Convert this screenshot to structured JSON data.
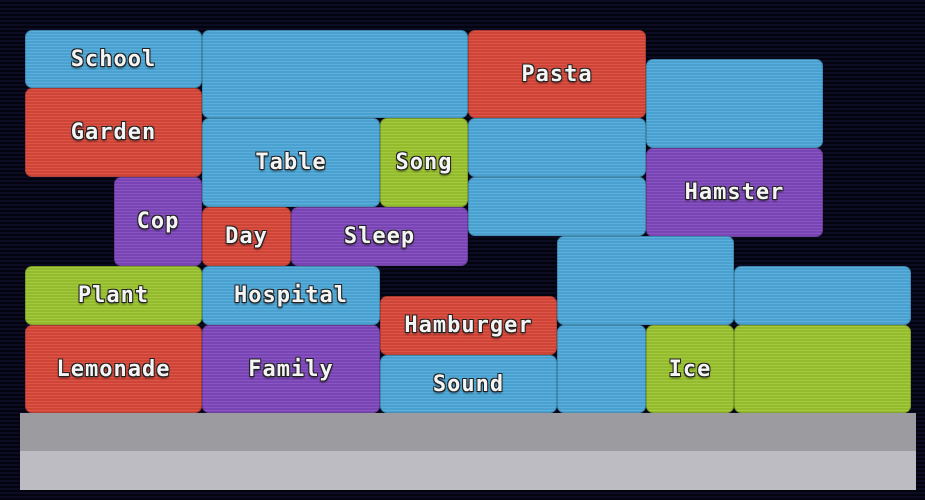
{
  "colors": {
    "blue": "#4ea9d9",
    "red": "#d9483a",
    "purple": "#8048bd",
    "green": "#9cc52f",
    "ground_dark": "#9c9ca0",
    "ground_light": "#bcbcc2"
  },
  "blocks": {
    "school": "School",
    "garden": "Garden",
    "cop": "Cop",
    "plant": "Plant",
    "lemonade": "Lemonade",
    "table": "Table",
    "song": "Song",
    "day": "Day",
    "sleep": "Sleep",
    "hospital": "Hospital",
    "family": "Family",
    "pasta": "Pasta",
    "hamburger": "Hamburger",
    "sound": "Sound",
    "hamster": "Hamster",
    "ice": "Ice"
  }
}
